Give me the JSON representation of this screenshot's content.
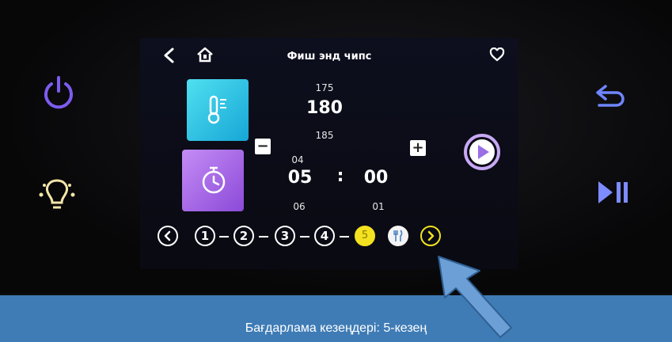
{
  "screen": {
    "title": "Фиш энд чипс",
    "temperature": {
      "above": "175",
      "current": "180",
      "below": "185"
    },
    "time": {
      "hours_above": "04",
      "hours": "05",
      "hours_below": "06",
      "separator": ":",
      "minutes": "00",
      "minutes_below": "01"
    },
    "minus_label": "−",
    "plus_label": "+",
    "steps": [
      {
        "label": "1"
      },
      {
        "label": "2"
      },
      {
        "label": "3"
      },
      {
        "label": "4"
      }
    ],
    "active_step": "5"
  },
  "icons": {
    "back": "chevron-left-icon",
    "home": "home-icon",
    "favorite": "heart-icon",
    "temperature": "thermometer-icon",
    "timer": "timer-icon",
    "play": "play-icon",
    "fork_knife": "fork-knife-icon",
    "power": "power-icon",
    "light": "bulb-icon",
    "undo": "undo-icon",
    "play_pause": "play-pause-icon"
  },
  "colors": {
    "power": "#7d5cf0",
    "light": "#f3e6a8",
    "undo": "#6f86ff",
    "active_step": "#f3e21f",
    "caption_bg": "#3f7cb6",
    "arrow": "#6c9fd6"
  },
  "caption": "Бағдарлама кезеңдері: 5-кезең"
}
